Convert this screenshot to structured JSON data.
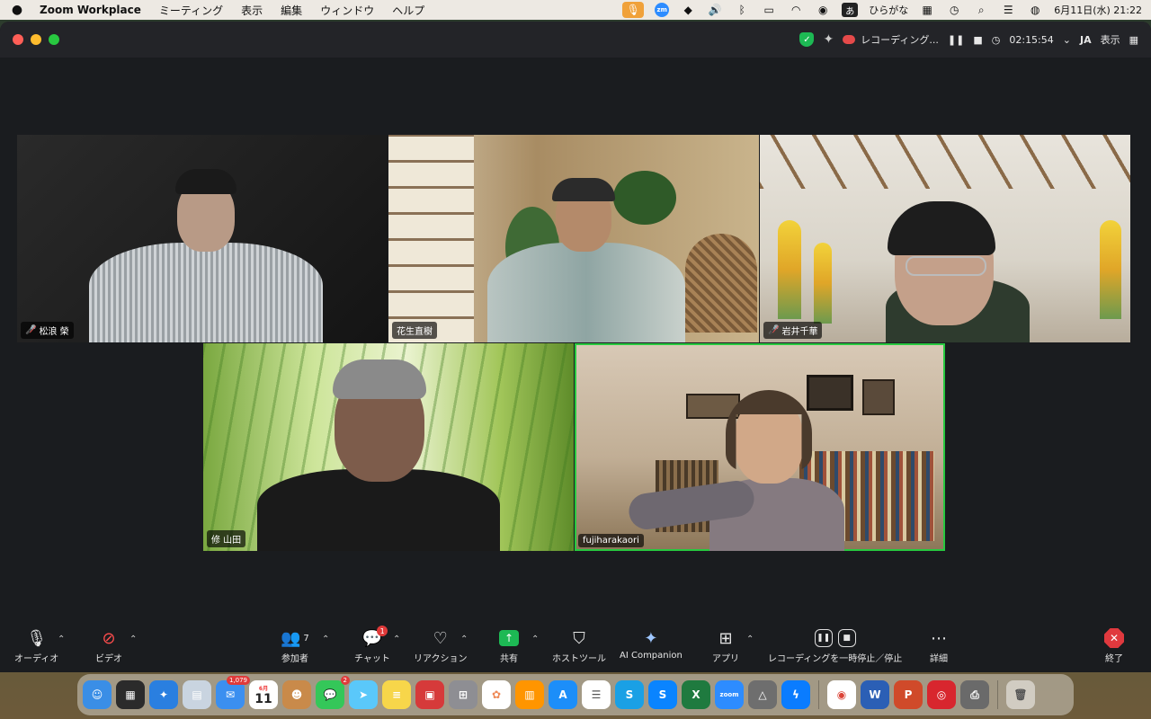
{
  "menubar": {
    "app_name": "Zoom Workplace",
    "items": [
      "ミーティング",
      "表示",
      "編集",
      "ウィンドウ",
      "ヘルプ"
    ],
    "input_method": "ひらがな",
    "input_mode_char": "あ",
    "datetime": "6月11日(水) 21:22"
  },
  "titlebar": {
    "recording_label": "レコーディング...",
    "timer": "02:15:54",
    "language": "JA",
    "view_label": "表示"
  },
  "participants": [
    {
      "name": "松浪 榮",
      "muted": true
    },
    {
      "name": "花生直樹",
      "muted": false
    },
    {
      "name": "岩井千華",
      "muted": true
    },
    {
      "name": "修 山田",
      "muted": false
    },
    {
      "name": "fujiharakaori",
      "muted": false,
      "active_speaker": true
    }
  ],
  "toolbar": {
    "audio": "オーディオ",
    "video": "ビデオ",
    "participants": "参加者",
    "participants_count": "7",
    "chat": "チャット",
    "chat_badge": "1",
    "reactions": "リアクション",
    "share": "共有",
    "host_tools": "ホストツール",
    "ai_companion": "AI Companion",
    "apps": "アプリ",
    "recording_control": "レコーディングを一時停止／停止",
    "more": "詳細",
    "end": "終了"
  },
  "dock": {
    "mail_badge": "1,079",
    "calendar_month": "6月",
    "calendar_day": "11",
    "messages_badge": "2"
  }
}
